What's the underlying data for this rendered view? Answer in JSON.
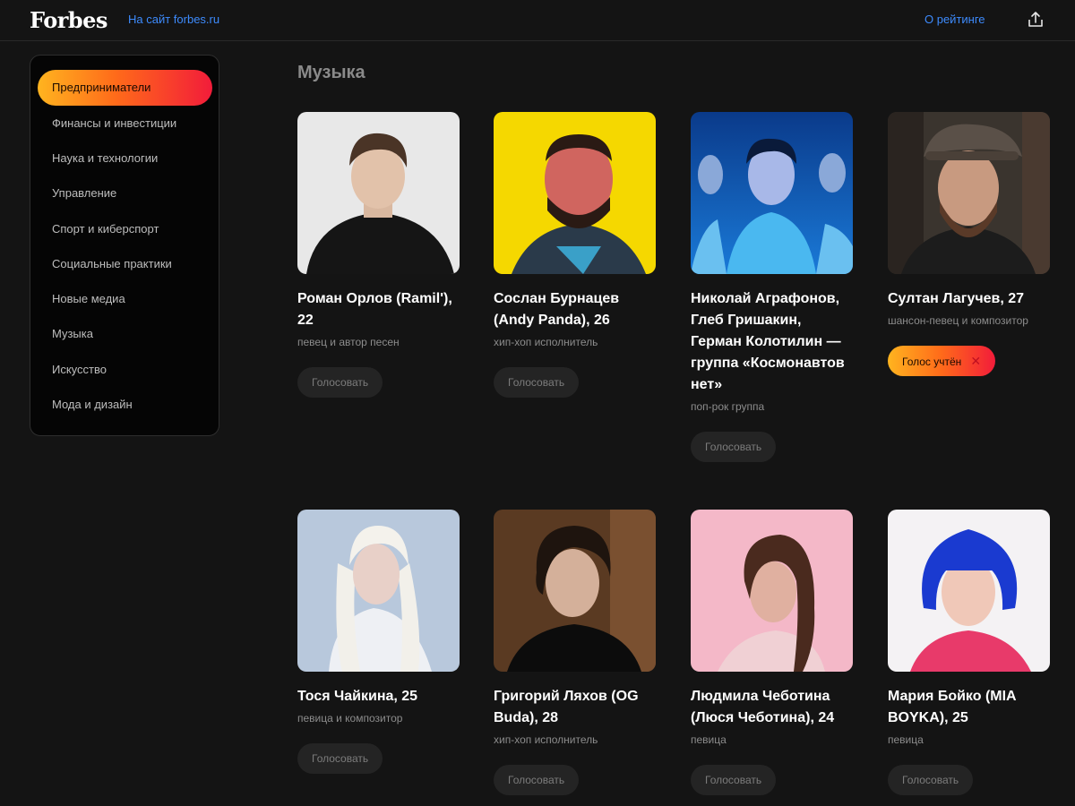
{
  "header": {
    "logo": "Forbes",
    "site_link": "На сайт forbes.ru",
    "about_link": "О рейтинге",
    "share_icon": "share-icon"
  },
  "sidebar": {
    "items": [
      {
        "label": "Предприниматели",
        "active": true
      },
      {
        "label": "Финансы и инвестиции"
      },
      {
        "label": "Наука и технологии"
      },
      {
        "label": "Управление"
      },
      {
        "label": "Спорт и киберспорт"
      },
      {
        "label": "Социальные практики"
      },
      {
        "label": "Новые медиа"
      },
      {
        "label": "Музыка"
      },
      {
        "label": "Искусство"
      },
      {
        "label": "Мода и дизайн"
      }
    ]
  },
  "section": {
    "title": "Музыка"
  },
  "vote_label": "Голосовать",
  "voted_label": "Голос учтён",
  "colors": {
    "accent_start": "#ffb41f",
    "accent_end": "#f21c3a",
    "link": "#3d8bfd",
    "background": "#141414"
  },
  "cards": [
    {
      "name": "Роман Орлов (Ramil'), 22",
      "role": "певец и автор песен",
      "voted": false
    },
    {
      "name": "Сослан Бурнацев (Andy Panda), 26",
      "role": "хип-хоп исполнитель",
      "voted": false
    },
    {
      "name": "Николай Аграфонов, Глеб Гришакин, Герман Колотилин — группа «Космонавтов нет»",
      "role": "поп-рок группа",
      "voted": false
    },
    {
      "name": "Султан Лагучев, 27",
      "role": "шансон-певец и композитор",
      "voted": true
    },
    {
      "name": "Тося Чайкина, 25",
      "role": "певица и композитор",
      "voted": false
    },
    {
      "name": "Григорий Ляхов (OG Buda), 28",
      "role": "хип-хоп исполнитель",
      "voted": false
    },
    {
      "name": "Людмила Чеботина (Люся Чеботина), 24",
      "role": "певица",
      "voted": false
    },
    {
      "name": "Мария Бойко (MIA BOYKA), 25",
      "role": "певица",
      "voted": false
    }
  ]
}
